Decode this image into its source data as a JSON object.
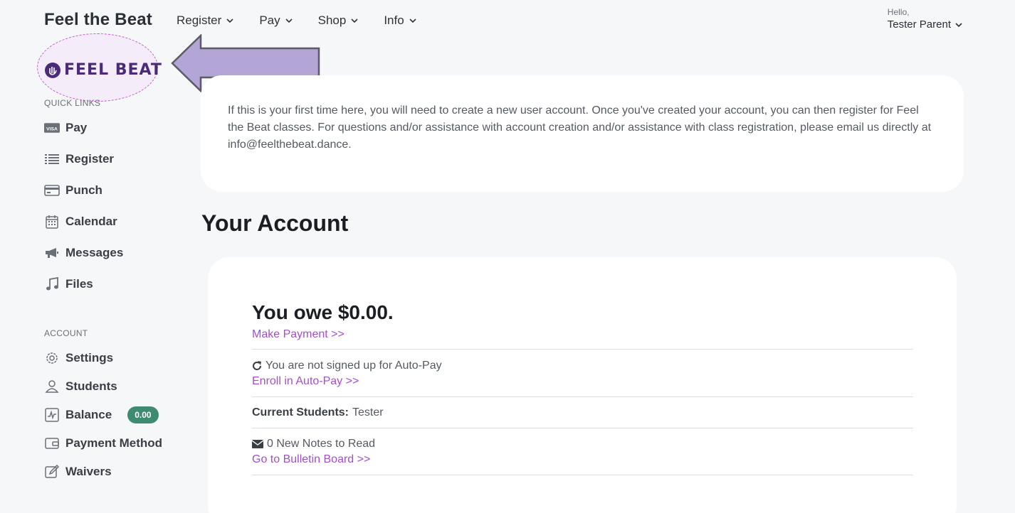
{
  "header": {
    "brand": "Feel the Beat",
    "nav": [
      "Register",
      "Pay",
      "Shop",
      "Info"
    ],
    "hello": "Hello,",
    "user_name": "Tester Parent"
  },
  "logo": {
    "text": "FEEL BEAT"
  },
  "sidebar": {
    "quick_links_title": "QUICK LINKS",
    "quick_links": [
      {
        "label": "Pay",
        "icon": "visa-card-icon"
      },
      {
        "label": "Register",
        "icon": "list-icon"
      },
      {
        "label": "Punch",
        "icon": "credit-card-icon"
      },
      {
        "label": "Calendar",
        "icon": "calendar-icon"
      },
      {
        "label": "Messages",
        "icon": "megaphone-icon"
      },
      {
        "label": "Files",
        "icon": "music-note-icon"
      }
    ],
    "account_title": "ACCOUNT",
    "account": [
      {
        "label": "Settings",
        "icon": "gear-icon"
      },
      {
        "label": "Students",
        "icon": "user-icon"
      },
      {
        "label": "Balance",
        "icon": "chart-icon",
        "badge": "0.00"
      },
      {
        "label": "Payment Method",
        "icon": "wallet-icon"
      },
      {
        "label": "Waivers",
        "icon": "edit-icon"
      }
    ]
  },
  "info": {
    "text": "If this is your first time here, you will need to create a new user account. Once you've created your account, you can then register for Feel the Beat classes. For questions and/or assistance with account creation and/or assistance with class registration, please email us directly at info@feelthebeat.dance."
  },
  "account": {
    "title": "Your Account",
    "owe": "You owe $0.00.",
    "make_payment": "Make Payment >>",
    "autopay_status": "You are not signed up for Auto-Pay",
    "enroll_autopay": "Enroll in Auto-Pay >>",
    "current_students_label": "Current Students:",
    "current_students_value": "Tester",
    "notes": "0 New Notes to Read",
    "bulletin": "Go to Bulletin Board >>"
  },
  "colors": {
    "accent": "#a34fc9",
    "badge": "#3f8b72",
    "logo": "#4b2a7a",
    "arrow": "#b3a6d6"
  }
}
